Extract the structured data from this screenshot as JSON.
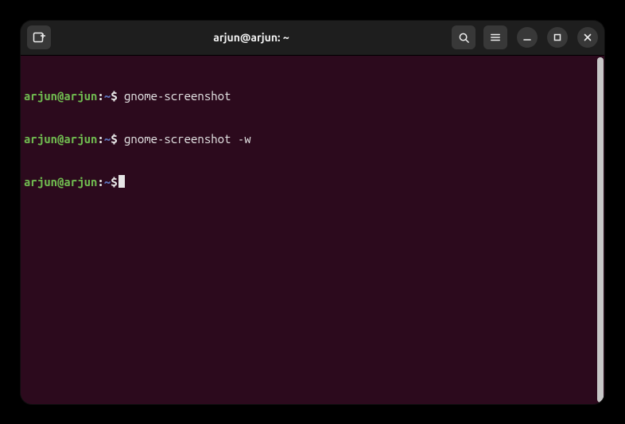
{
  "window": {
    "title": "arjun@arjun: ~"
  },
  "prompt": {
    "user_host": "arjun@arjun",
    "colon": ":",
    "path": "~",
    "dollar": "$"
  },
  "lines": [
    {
      "command": " gnome-screenshot"
    },
    {
      "command": " gnome-screenshot -w"
    },
    {
      "command": ""
    }
  ],
  "icons": {
    "new_tab": "new-tab-icon",
    "search": "search-icon",
    "menu": "hamburger-menu-icon",
    "minimize": "minimize-icon",
    "maximize": "maximize-icon",
    "close": "close-icon"
  }
}
